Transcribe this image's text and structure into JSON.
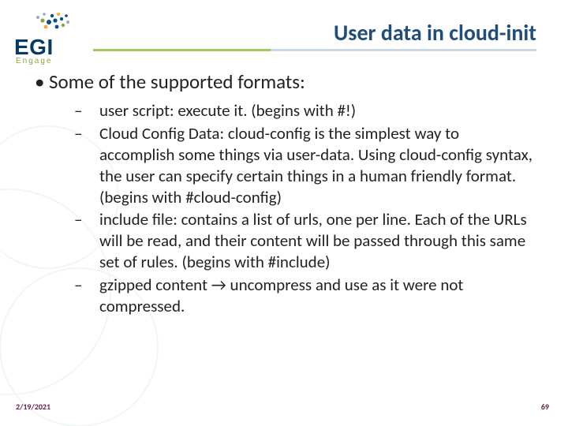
{
  "logo": {
    "name": "EGI",
    "tagline": "Engage"
  },
  "title": "User data in cloud-init",
  "heading": "Some of the supported formats:",
  "items": [
    "user script: execute it. (begins with #!)",
    "Cloud Config Data: cloud-config is the simplest way to accomplish some things via user-data. Using cloud-config syntax, the user can specify certain things in a human friendly format. (begins with #cloud-config)",
    "include file: contains a list of urls, one per line. Each of the URLs will be read, and their content will be passed through this same set of rules. (begins with #include)",
    "gzipped content → uncompress and use as it were not compressed."
  ],
  "footer": {
    "date": "2/19/2021",
    "page": "69"
  }
}
